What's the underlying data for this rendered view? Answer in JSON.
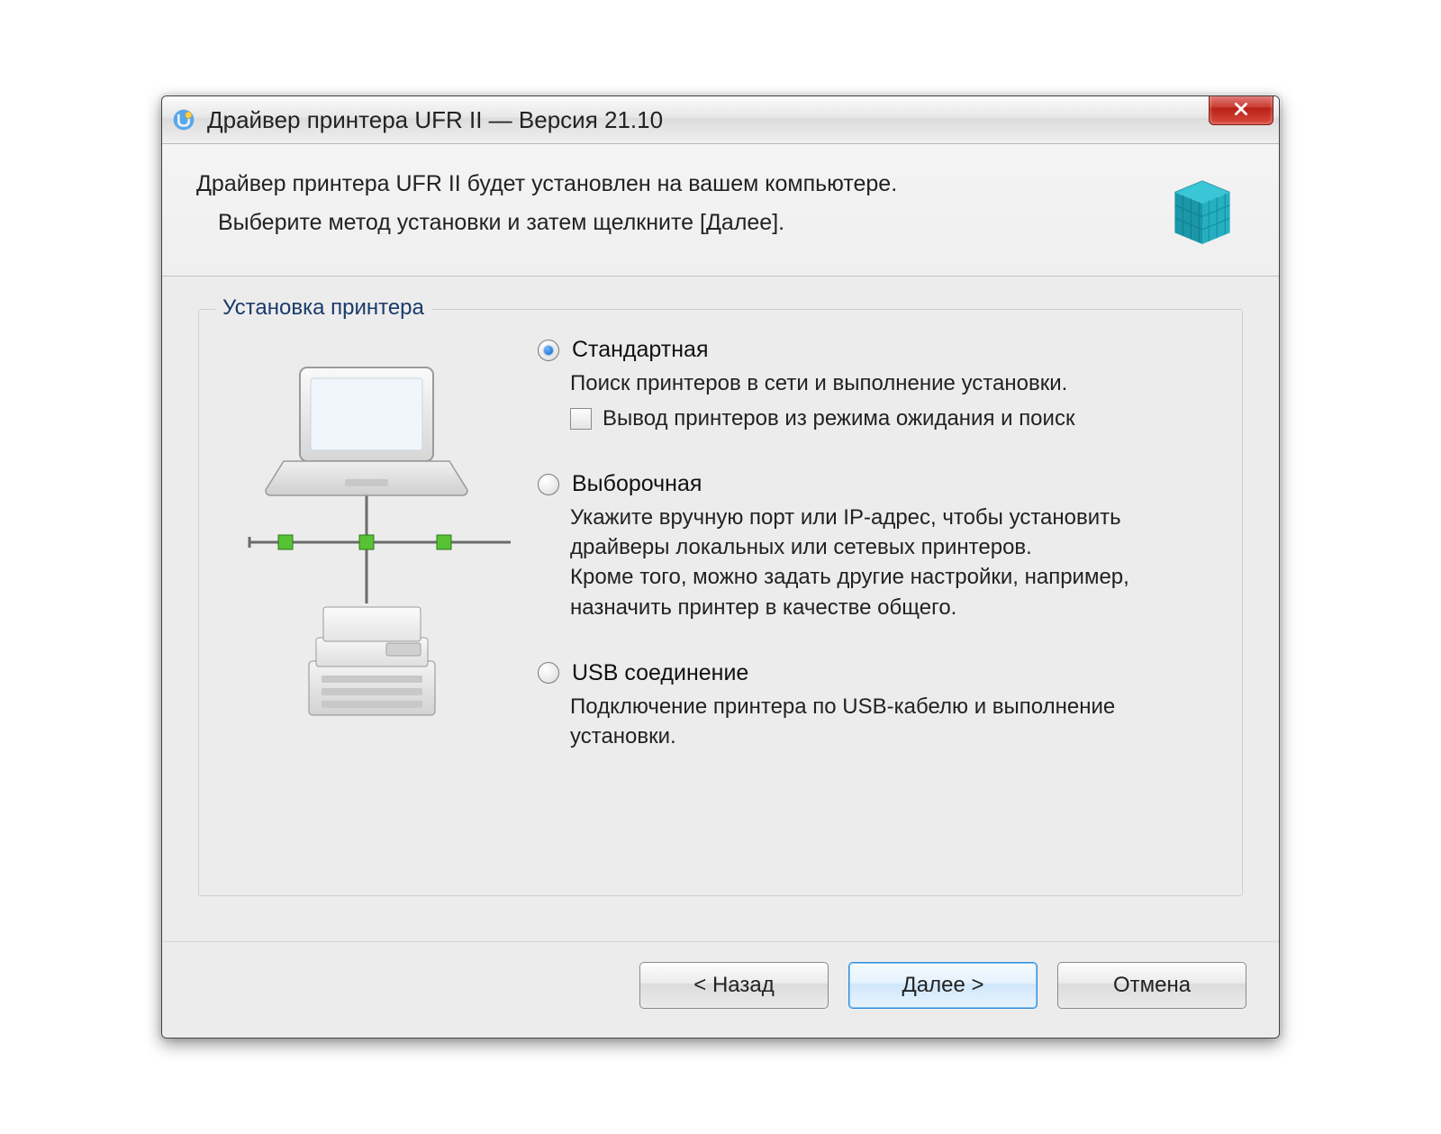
{
  "titlebar": {
    "title": "Драйвер принтера UFR II — Версия 21.10"
  },
  "header": {
    "line1": "Драйвер принтера UFR II будет установлен на вашем компьютере.",
    "line2": "Выберите метод установки и затем щелкните [Далее]."
  },
  "group": {
    "label": "Установка принтера"
  },
  "options": {
    "standard": {
      "label": "Стандартная",
      "desc": "Поиск принтеров в сети и выполнение установки.",
      "checkbox_label": "Вывод принтеров из режима ожидания и поиск",
      "checked": true,
      "checkbox_checked": false
    },
    "custom": {
      "label": "Выборочная",
      "desc": "Укажите вручную порт или IP-адрес, чтобы установить драйверы локальных или сетевых принтеров.\nКроме того, можно задать другие настройки, например, назначить принтер в качестве общего.",
      "checked": false
    },
    "usb": {
      "label": "USB соединение",
      "desc": "Подключение принтера по USB-кабелю и выполнение установки.",
      "checked": false
    }
  },
  "footer": {
    "back": "< Назад",
    "next": "Далее >",
    "cancel": "Отмена"
  }
}
